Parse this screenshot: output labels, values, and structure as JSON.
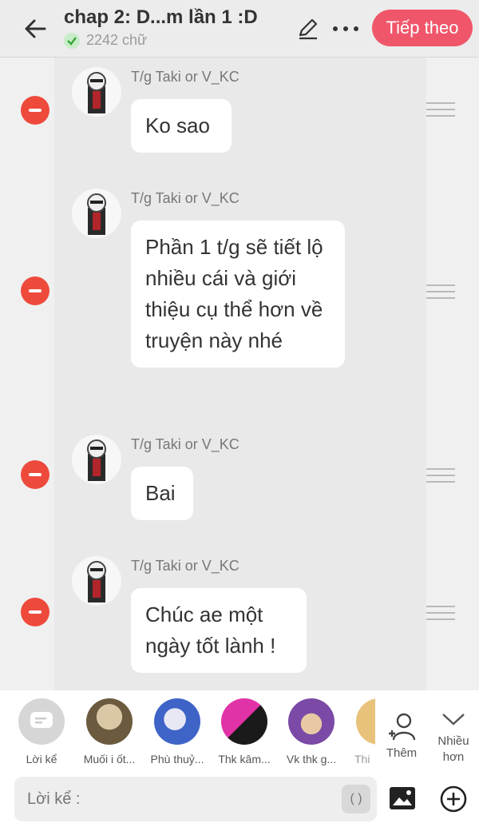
{
  "header": {
    "title": "chap 2: D...m lần 1 :D",
    "word_count": "2242 chữ",
    "next_label": "Tiếp theo"
  },
  "messages": [
    {
      "author": "T/g Taki or V_KC",
      "text": "Ko sao"
    },
    {
      "author": "T/g Taki or V_KC",
      "text": "Phần 1 t/g sẽ tiết lộ nhiều cái và giới thiệu cụ thể hơn về truyện này nhé"
    },
    {
      "author": "T/g Taki or V_KC",
      "text": "Bai"
    },
    {
      "author": "T/g Taki or V_KC",
      "text": "Chúc ae một ngày tốt lành !"
    }
  ],
  "characters": [
    {
      "name": "Lời kể"
    },
    {
      "name": "Muối i ốt..."
    },
    {
      "name": "Phù thuỷ..."
    },
    {
      "name": "Thk kâm..."
    },
    {
      "name": "Vk thk g..."
    },
    {
      "name": "Thi"
    }
  ],
  "more": {
    "add_label": "Thêm",
    "more_label": "Nhiều hơn"
  },
  "composer": {
    "placeholder": "Lời kể :",
    "paren": "( )"
  },
  "colors": {
    "accent": "#f0566a",
    "delete": "#ee4a3c"
  }
}
